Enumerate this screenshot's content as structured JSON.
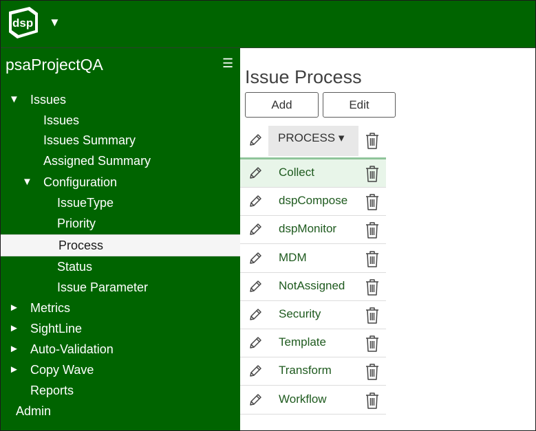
{
  "header": {
    "logo_text": "dsp",
    "logo_caret": "▼"
  },
  "sidebar": {
    "project_title": "psaProjectQA",
    "menu_icon": "☰",
    "items": [
      {
        "label": "Issues",
        "arrow": "▼"
      },
      {
        "label": "Issues"
      },
      {
        "label": "Issues Summary"
      },
      {
        "label": "Assigned Summary"
      },
      {
        "label": "Configuration",
        "arrow": "▼"
      },
      {
        "label": "IssueType"
      },
      {
        "label": "Priority"
      },
      {
        "label": "Process",
        "active": true
      },
      {
        "label": "Status"
      },
      {
        "label": "Issue Parameter"
      },
      {
        "label": "Metrics",
        "arrow": "►"
      },
      {
        "label": "SightLine",
        "arrow": "►"
      },
      {
        "label": "Auto-Validation",
        "arrow": "►"
      },
      {
        "label": "Copy Wave",
        "arrow": "►"
      },
      {
        "label": "Reports"
      },
      {
        "label": "Admin"
      }
    ]
  },
  "main": {
    "title": "Issue Process",
    "add_label": "Add",
    "edit_label": "Edit",
    "column_header": "PROCESS ▾",
    "rows": [
      {
        "name": "Collect"
      },
      {
        "name": "dspCompose"
      },
      {
        "name": "dspMonitor"
      },
      {
        "name": "MDM"
      },
      {
        "name": "NotAssigned"
      },
      {
        "name": "Security"
      },
      {
        "name": "Template"
      },
      {
        "name": "Transform"
      },
      {
        "name": "Workflow"
      }
    ]
  },
  "colors": {
    "brand_green": "#006400",
    "row_highlight": "#e8f5e9",
    "link_green": "#1e5a1e"
  }
}
